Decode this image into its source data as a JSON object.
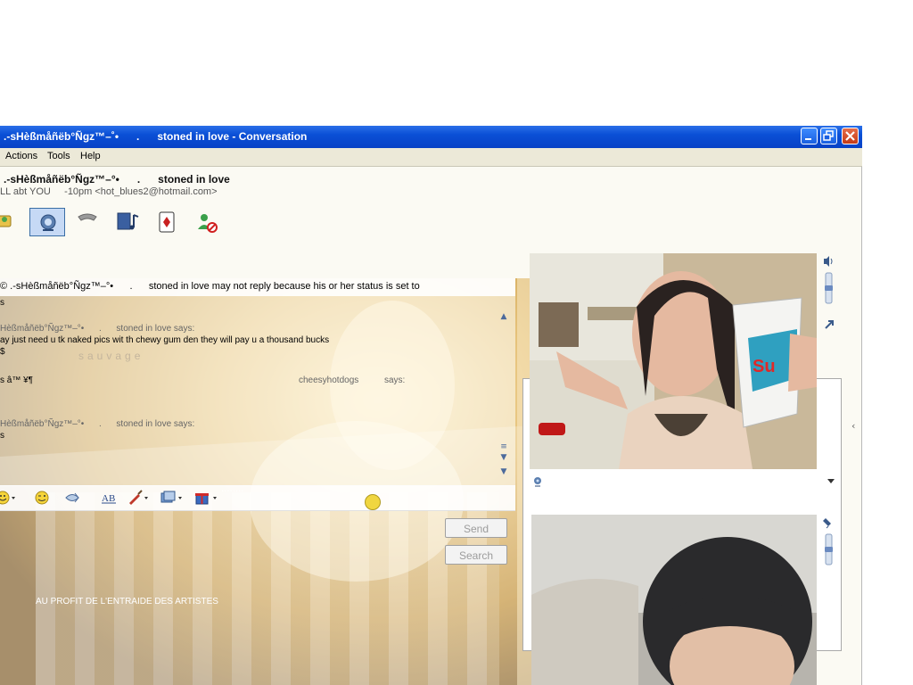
{
  "window": {
    "title": ".-sHèßmåñëb°Ñgz™–˚•      .      stoned in love - Conversation",
    "minimize_icon": "minimize-icon",
    "restore_icon": "restore-icon",
    "close_icon": "close-icon"
  },
  "menu": {
    "items": [
      "Actions",
      "Tools",
      "Help"
    ]
  },
  "contact": {
    "name": ".-sHèßmåñëb°Ñgz™–°•      .      stoned in love",
    "personal_message": "LL abt YOU     -10pm <hot_blues2@hotmail.com>"
  },
  "toolbar": {
    "tools": [
      "invite-icon",
      "webcam-icon",
      "call-icon",
      "media-icon",
      "games-icon",
      "block-icon"
    ],
    "active_index": 1
  },
  "chat": {
    "status_notice": "© .-sHèßmåñëb°Ñgz™–°•      .      stoned in love may not reply because his or her status is set to",
    "lines": [
      {
        "text": "s",
        "style": "dark"
      },
      {
        "text": "Hèßmåñëb°Ñgz™–°•      .      stoned in love says:",
        "style": "grey"
      },
      {
        "text": "ay just need u tk naked pics wit th chewy gum den they will pay u a thousand bucks",
        "style": "dark"
      },
      {
        "text": "$",
        "style": "dark"
      },
      {
        "text": "s â™ ¥¶",
        "style": "dark"
      },
      {
        "text": "Hèßmåñëb°Ñgz™–°•      .      stoned in love says:",
        "style": "grey"
      },
      {
        "text": "s",
        "style": "dark"
      }
    ],
    "other_speaker": "cheesyhotdogs",
    "other_says": "says:",
    "wallpaper_text": "sauvage",
    "wallpaper_caption": "AU PROFIT DE L'ENTRAIDE DES ARTISTES"
  },
  "format_toolbar": {
    "items": [
      "emoticon-icon",
      "wink-icon",
      "nudge-icon",
      "font-icon",
      "paint-icon",
      "background-icon",
      "gift-icon"
    ]
  },
  "compose": {
    "send_label": "Send",
    "search_label": "Search"
  },
  "video": {
    "remote_volume_icon": "speaker-icon",
    "local_mic_icon": "microphone-icon",
    "popout_icon": "popout-icon",
    "dropdown_icon": "dropdown-arrow-icon",
    "collapse_icon": "chevron-left-icon"
  },
  "colors": {
    "titlebar": "#0a4fd6",
    "menubar": "#ece9d8",
    "close_button": "#c43a16"
  }
}
